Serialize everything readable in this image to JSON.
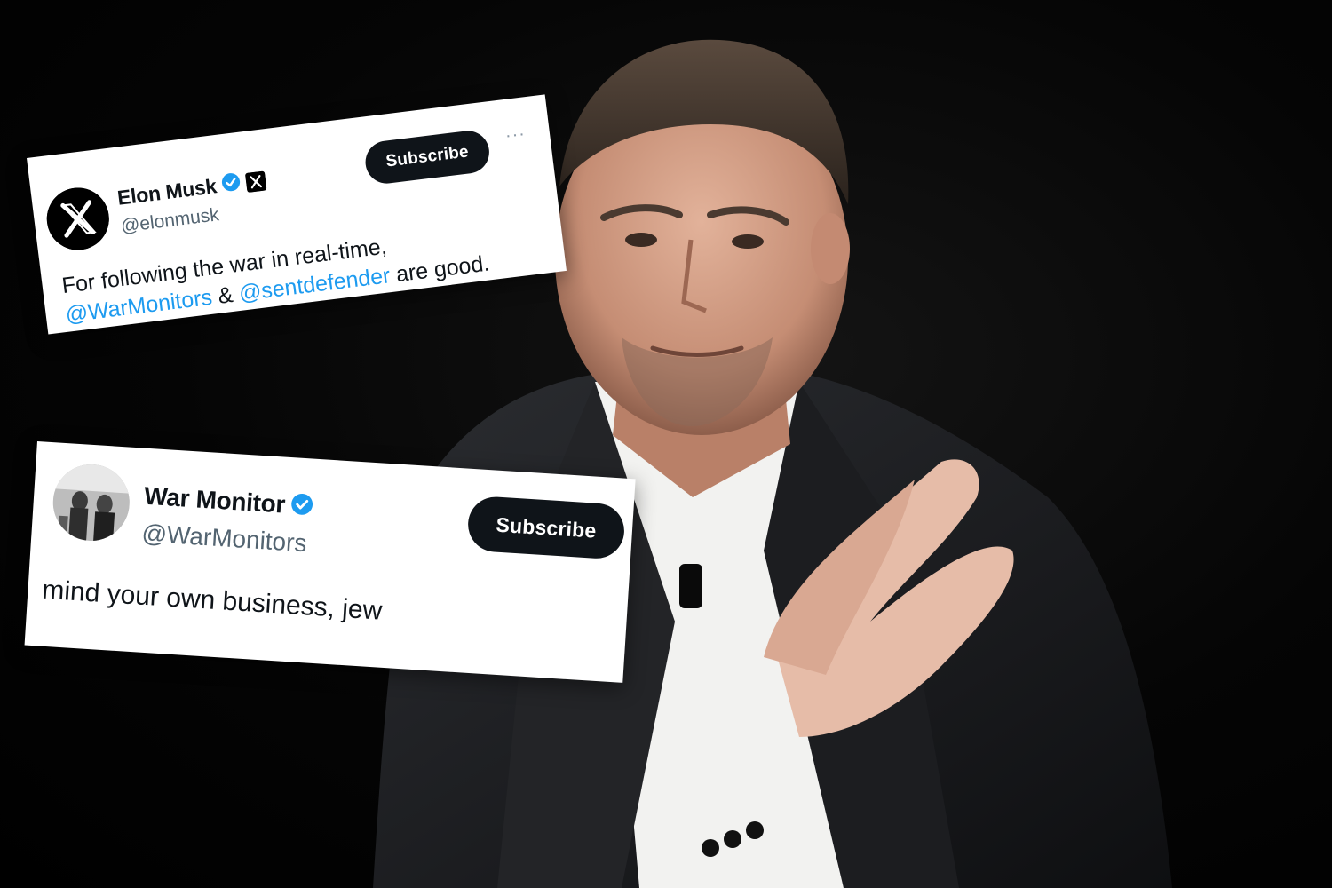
{
  "tweets": [
    {
      "display_name": "Elon Musk",
      "handle": "@elonmusk",
      "subscribe_label": "Subscribe",
      "more_label": "···",
      "text_line1": "For following the war in real-time,",
      "mention_1": "@WarMonitors",
      "connector": " & ",
      "mention_2": "@sentdefender",
      "text_end": " are good.",
      "avatar_icon": "x-logo-icon",
      "badges": [
        "verified-badge-icon",
        "x-affiliate-badge-icon"
      ]
    },
    {
      "display_name": "War Monitor",
      "handle": "@WarMonitors",
      "subscribe_label": "Subscribe",
      "text": "mind your own business, jew",
      "avatar_icon": "photo-avatar",
      "badges": [
        "verified-badge-icon"
      ]
    }
  ],
  "colors": {
    "background": "#000000",
    "mention_blue": "#1d9bf0",
    "verified_blue": "#1d9bf0",
    "button_dark": "#0f1419",
    "handle_gray": "#536471"
  }
}
